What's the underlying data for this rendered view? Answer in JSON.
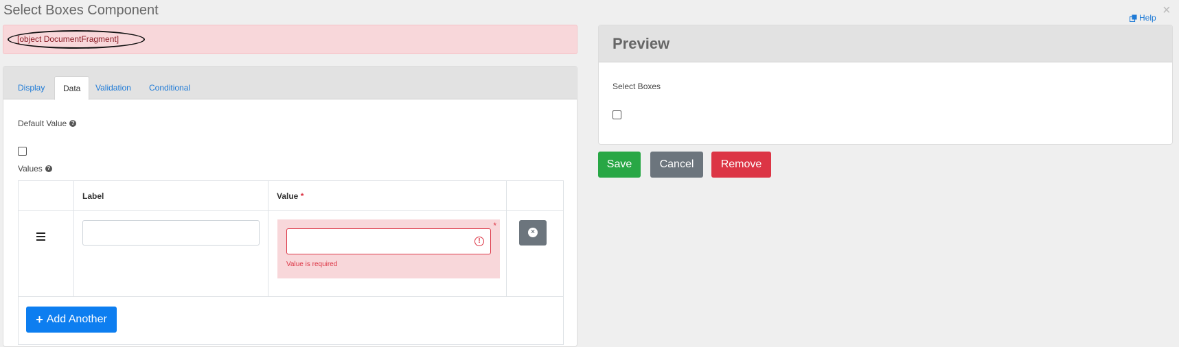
{
  "page": {
    "title": "Select Boxes Component",
    "help_label": "Help",
    "close_glyph": "×"
  },
  "error_banner": {
    "text": "[object DocumentFragment]"
  },
  "edit_panel": {
    "tabs": [
      {
        "label": "Display",
        "active": false
      },
      {
        "label": "Data",
        "active": true
      },
      {
        "label": "Validation",
        "active": false
      },
      {
        "label": "Conditional",
        "active": false
      }
    ],
    "default_value_label": "Default Value",
    "values_label": "Values",
    "table": {
      "label_header": "Label",
      "value_header": "Value",
      "required_mark": "*",
      "rows": [
        {
          "label_value": "",
          "value_value": "",
          "error": "Value is required"
        }
      ]
    },
    "add_another_label": "Add Another"
  },
  "preview": {
    "heading": "Preview",
    "field_label": "Select Boxes"
  },
  "actions": {
    "save_label": "Save",
    "cancel_label": "Cancel",
    "remove_label": "Remove"
  },
  "colors": {
    "save": "#28a745",
    "cancel": "#6c757d",
    "remove": "#dc3545",
    "primary": "#0d7ef0",
    "error_bg": "#f8d7da"
  },
  "icons": {
    "help": "external-window-icon",
    "question": "question-circle-icon",
    "drag": "bars-icon",
    "alert": "exclamation-circle-icon",
    "remove_row": "times-circle-icon",
    "add": "plus-icon"
  }
}
